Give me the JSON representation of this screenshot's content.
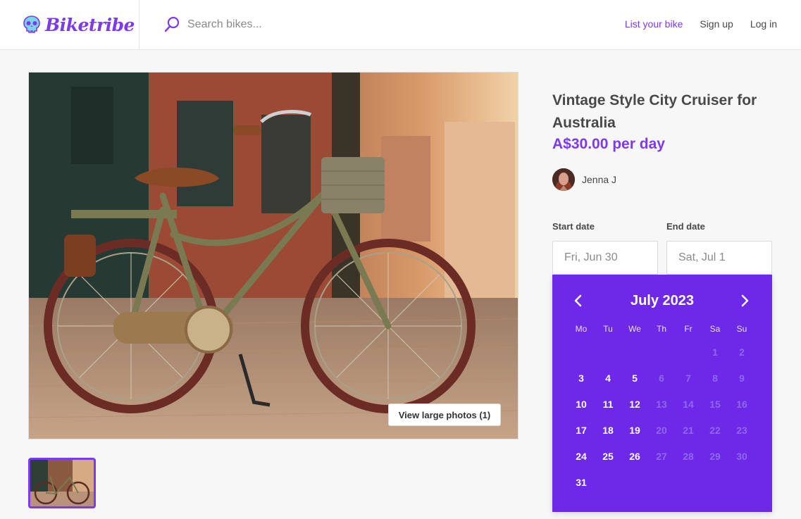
{
  "brand": {
    "name": "Biketribe",
    "accent": "#7c3aed"
  },
  "search": {
    "placeholder": "Search bikes..."
  },
  "nav": {
    "list_bike": "List your bike",
    "sign_up": "Sign up",
    "log_in": "Log in"
  },
  "gallery": {
    "view_large": "View large photos (1)"
  },
  "listing": {
    "title": "Vintage Style City Cruiser for Australia",
    "price": "A$30.00 per day",
    "owner": "Jenna J"
  },
  "booking": {
    "start_label": "Start date",
    "end_label": "End date",
    "start_placeholder": "Fri, Jun 30",
    "end_placeholder": "Sat, Jul 1"
  },
  "calendar": {
    "month": "July 2023",
    "weekdays": [
      "Mo",
      "Tu",
      "We",
      "Th",
      "Fr",
      "Sa",
      "Su"
    ],
    "weeks": [
      [
        "",
        "",
        "",
        "",
        "",
        "1",
        "2"
      ],
      [
        "3",
        "4",
        "5",
        "6",
        "7",
        "8",
        "9"
      ],
      [
        "10",
        "11",
        "12",
        "13",
        "14",
        "15",
        "16"
      ],
      [
        "17",
        "18",
        "19",
        "20",
        "21",
        "22",
        "23"
      ],
      [
        "24",
        "25",
        "26",
        "27",
        "28",
        "29",
        "30"
      ],
      [
        "31",
        "",
        "",
        "",
        "",
        "",
        ""
      ]
    ],
    "available_days": [
      "3",
      "4",
      "5",
      "10",
      "11",
      "12",
      "17",
      "18",
      "19",
      "24",
      "25",
      "26",
      "31"
    ],
    "background": "#6d28e8"
  }
}
